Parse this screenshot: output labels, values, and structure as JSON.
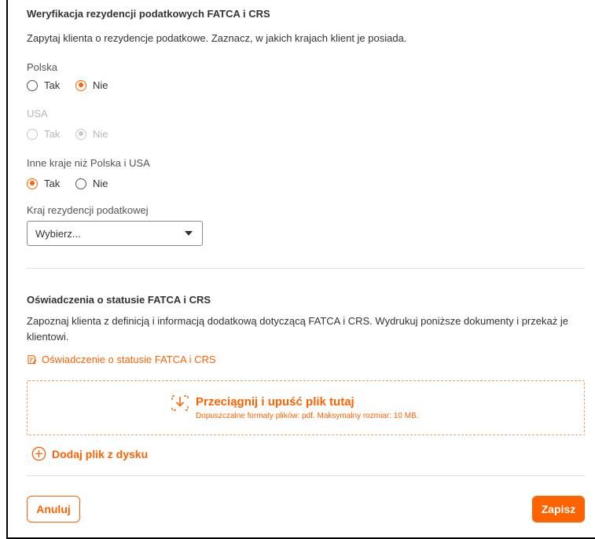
{
  "section1": {
    "title": "Weryfikacja rezydencji podatkowych FATCA i CRS",
    "description": "Zapytaj klienta o rezydencje podatkowe. Zaznacz, w jakich krajach klient je posiada.",
    "poland": {
      "label": "Polska",
      "yes": "Tak",
      "no": "Nie",
      "selected": "no"
    },
    "usa": {
      "label": "USA",
      "yes": "Tak",
      "no": "Nie",
      "selected": "no",
      "disabled": true
    },
    "other": {
      "label": "Inne kraje niż Polska i USA",
      "yes": "Tak",
      "no": "Nie",
      "selected": "yes"
    },
    "country": {
      "label": "Kraj rezydencji podatkowej",
      "value": "Wybierz..."
    }
  },
  "section2": {
    "title": "Oświadczenia o statusie FATCA i CRS",
    "description": "Zapoznaj klienta z definicją i informacją dodatkową dotyczącą FATCA i CRS. Wydrukuj poniższe dokumenty i przekaż je klientowi.",
    "document_link": "Oświadczenie o statusie FATCA i CRS",
    "dropzone": {
      "title": "Przeciągnij i upuść plik tutaj",
      "subtitle": "Dopuszczalne formaty plików: pdf. Maksymalny rozmiar: 10 MB."
    },
    "add_file": "Dodaj plik z dysku"
  },
  "footer": {
    "cancel": "Anuluj",
    "save": "Zapisz"
  },
  "colors": {
    "accent": "#ff6200",
    "text": "#333333",
    "disabled": "#b8b8b8"
  }
}
